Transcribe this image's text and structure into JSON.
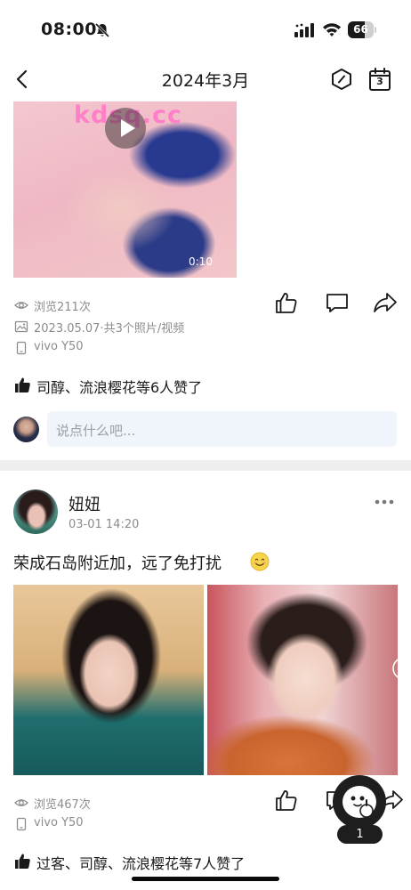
{
  "status_bar": {
    "time": "08:00",
    "battery_level": 66,
    "battery_text": "66"
  },
  "nav": {
    "title": "2024年3月",
    "calendar_day": "3"
  },
  "post1": {
    "watermark": "kdsq.cc",
    "video_duration": "0:10",
    "views": "浏览211次",
    "album_info": "2023.05.07·共3个照片/视频",
    "device": "vivo Y50",
    "likes": "司醇、流浪樱花等6人赞了",
    "comment_placeholder": "说点什么吧..."
  },
  "post2": {
    "author": "妞妞",
    "time": "03-01 14:20",
    "text": "荣成石岛附近加，远了免打扰",
    "views": "浏览467次",
    "device": "vivo Y50",
    "likes": "过客、司醇、流浪樱花等7人赞了"
  },
  "assistant": {
    "badge_count": "1"
  },
  "colors": {
    "watermark": "#ff7fc8",
    "meta_text": "#8c8c8c",
    "comment_bg": "#f0f4fb",
    "divider": "#eeeeee"
  },
  "icons": [
    "bell-slash-icon",
    "signal-icon",
    "wifi-icon",
    "battery-icon",
    "back-icon",
    "hexagon-icon",
    "calendar-icon",
    "play-icon",
    "eye-icon",
    "album-icon",
    "phone-icon",
    "thumbs-up-icon",
    "comment-icon",
    "share-icon",
    "more-icon",
    "smile-emoji-icon"
  ]
}
